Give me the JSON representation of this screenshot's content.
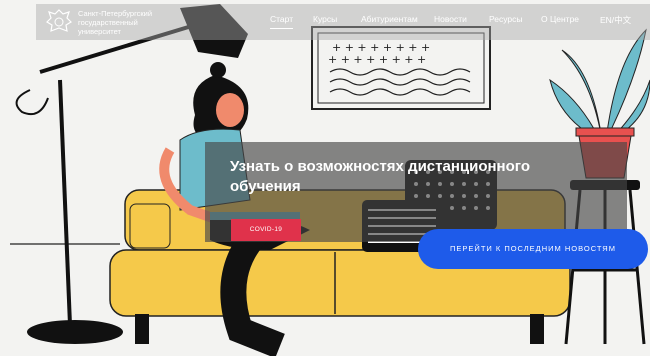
{
  "header": {
    "university_name": "Санкт-Петербургский\nгосударственный\nуниверситет",
    "nav": [
      {
        "label": "Старт",
        "active": true
      },
      {
        "label": "Курсы"
      },
      {
        "label": "Абитуриентам"
      },
      {
        "label": "Новости"
      },
      {
        "label": "Ресурсы"
      },
      {
        "label": "О Центре"
      },
      {
        "label": "EN/中文"
      }
    ]
  },
  "banner": {
    "title": "Узнать о возможностях дистанционного обучения",
    "badge_label": "COVID-19"
  },
  "cta": {
    "label": "ПЕРЕЙТИ К ПОСЛЕДНИМ НОВОСТЯМ"
  },
  "picture": {
    "frame_symbols": "+ + + + + + + +"
  },
  "colors": {
    "accent_blue": "#1e5bea",
    "badge_red": "#e0324b",
    "sofa_yellow": "#f5c94a",
    "plant_teal": "#6dbccb",
    "pot_red": "#e8514f"
  }
}
